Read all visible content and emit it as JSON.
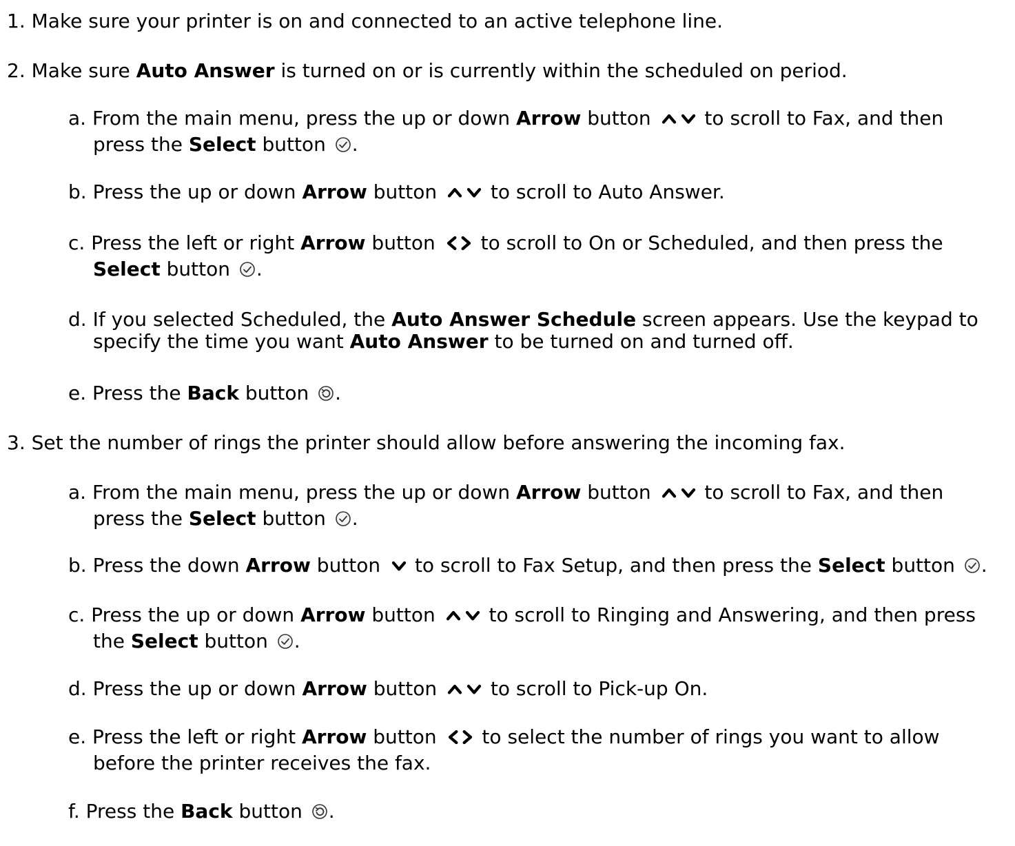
{
  "steps": [
    {
      "num": "1.",
      "text": "Make sure your printer is on and connected to an active telephone line."
    },
    {
      "num": "2.",
      "pre": "Make sure ",
      "bold": "Auto Answer",
      "post": " is turned on or is currently within the scheduled on period.",
      "substeps": [
        {
          "letter": "a.",
          "l1a": "From the main menu, press the up or down ",
          "l1b": "Arrow",
          "l1c": " button ",
          "l1d": " to scroll to Fax, and then",
          "l2a": "press the ",
          "l2b": "Select",
          "l2c": " button ",
          "l2d": "."
        },
        {
          "letter": "b.",
          "a": "Press the up or down ",
          "b": "Arrow",
          "c": " button ",
          "d": " to scroll to Auto Answer."
        },
        {
          "letter": "c.",
          "l1a": "Press the left or right ",
          "l1b": "Arrow",
          "l1c": " button ",
          "l1d": " to scroll to On or Scheduled, and then press the",
          "l2b": "Select",
          "l2c": " button ",
          "l2d": "."
        },
        {
          "letter": "d.",
          "l1a": "If you selected Scheduled, the ",
          "l1b": "Auto Answer Schedule",
          "l1c": " screen appears. Use the keypad to",
          "l2a": "specify the time you want ",
          "l2b": "Auto Answer",
          "l2c": " to be turned on and turned off."
        },
        {
          "letter": "e.",
          "a": "Press the ",
          "b": "Back",
          "c": " button ",
          "d": "."
        }
      ]
    },
    {
      "num": "3.",
      "text": "Set the number of rings the printer should allow before answering the incoming fax.",
      "substeps": [
        {
          "letter": "a.",
          "l1a": "From the main menu, press the up or down ",
          "l1b": "Arrow",
          "l1c": " button ",
          "l1d": " to scroll to Fax, and then",
          "l2a": "press the ",
          "l2b": "Select",
          "l2c": " button ",
          "l2d": "."
        },
        {
          "letter": "b.",
          "a": "Press the down ",
          "b": "Arrow",
          "c": " button ",
          "d": " to scroll to Fax Setup, and then press the ",
          "e": "Select",
          "f": " button ",
          "g": "."
        },
        {
          "letter": "c.",
          "l1a": "Press the up or down ",
          "l1b": "Arrow",
          "l1c": " button ",
          "l1d": " to scroll to Ringing and Answering, and then press",
          "l2a": "the ",
          "l2b": "Select",
          "l2c": " button ",
          "l2d": "."
        },
        {
          "letter": "d.",
          "a": "Press the up or down ",
          "b": "Arrow",
          "c": " button ",
          "d": " to scroll to Pick-up On."
        },
        {
          "letter": "e.",
          "l1a": "Press the left or right ",
          "l1b": "Arrow",
          "l1c": " button ",
          "l1d": " to select the number of rings you want to allow",
          "l2a": "before the printer receives the fax."
        },
        {
          "letter": "f.",
          "a": "Press the ",
          "b": "Back",
          "c": " button ",
          "d": "."
        }
      ]
    }
  ],
  "icons": {
    "up_down_arrow": "up-down-arrow-icon",
    "down_arrow": "down-arrow-icon",
    "left_right_arrow": "left-right-arrow-icon",
    "select": "select-checkmark-icon",
    "back": "back-icon"
  }
}
